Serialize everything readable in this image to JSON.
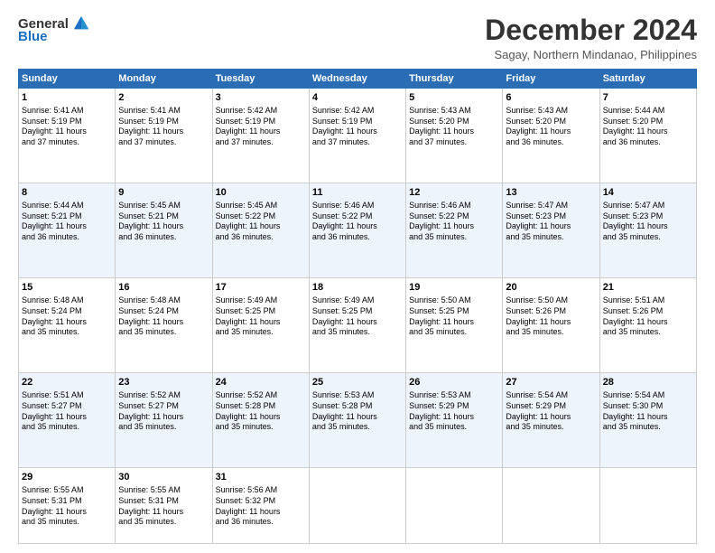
{
  "logo": {
    "general": "General",
    "blue": "Blue"
  },
  "title": "December 2024",
  "location": "Sagay, Northern Mindanao, Philippines",
  "headers": [
    "Sunday",
    "Monday",
    "Tuesday",
    "Wednesday",
    "Thursday",
    "Friday",
    "Saturday"
  ],
  "weeks": [
    [
      {
        "day": "1",
        "info": "Sunrise: 5:41 AM\nSunset: 5:19 PM\nDaylight: 11 hours\nand 37 minutes."
      },
      {
        "day": "2",
        "info": "Sunrise: 5:41 AM\nSunset: 5:19 PM\nDaylight: 11 hours\nand 37 minutes."
      },
      {
        "day": "3",
        "info": "Sunrise: 5:42 AM\nSunset: 5:19 PM\nDaylight: 11 hours\nand 37 minutes."
      },
      {
        "day": "4",
        "info": "Sunrise: 5:42 AM\nSunset: 5:19 PM\nDaylight: 11 hours\nand 37 minutes."
      },
      {
        "day": "5",
        "info": "Sunrise: 5:43 AM\nSunset: 5:20 PM\nDaylight: 11 hours\nand 37 minutes."
      },
      {
        "day": "6",
        "info": "Sunrise: 5:43 AM\nSunset: 5:20 PM\nDaylight: 11 hours\nand 36 minutes."
      },
      {
        "day": "7",
        "info": "Sunrise: 5:44 AM\nSunset: 5:20 PM\nDaylight: 11 hours\nand 36 minutes."
      }
    ],
    [
      {
        "day": "8",
        "info": "Sunrise: 5:44 AM\nSunset: 5:21 PM\nDaylight: 11 hours\nand 36 minutes."
      },
      {
        "day": "9",
        "info": "Sunrise: 5:45 AM\nSunset: 5:21 PM\nDaylight: 11 hours\nand 36 minutes."
      },
      {
        "day": "10",
        "info": "Sunrise: 5:45 AM\nSunset: 5:22 PM\nDaylight: 11 hours\nand 36 minutes."
      },
      {
        "day": "11",
        "info": "Sunrise: 5:46 AM\nSunset: 5:22 PM\nDaylight: 11 hours\nand 36 minutes."
      },
      {
        "day": "12",
        "info": "Sunrise: 5:46 AM\nSunset: 5:22 PM\nDaylight: 11 hours\nand 35 minutes."
      },
      {
        "day": "13",
        "info": "Sunrise: 5:47 AM\nSunset: 5:23 PM\nDaylight: 11 hours\nand 35 minutes."
      },
      {
        "day": "14",
        "info": "Sunrise: 5:47 AM\nSunset: 5:23 PM\nDaylight: 11 hours\nand 35 minutes."
      }
    ],
    [
      {
        "day": "15",
        "info": "Sunrise: 5:48 AM\nSunset: 5:24 PM\nDaylight: 11 hours\nand 35 minutes."
      },
      {
        "day": "16",
        "info": "Sunrise: 5:48 AM\nSunset: 5:24 PM\nDaylight: 11 hours\nand 35 minutes."
      },
      {
        "day": "17",
        "info": "Sunrise: 5:49 AM\nSunset: 5:25 PM\nDaylight: 11 hours\nand 35 minutes."
      },
      {
        "day": "18",
        "info": "Sunrise: 5:49 AM\nSunset: 5:25 PM\nDaylight: 11 hours\nand 35 minutes."
      },
      {
        "day": "19",
        "info": "Sunrise: 5:50 AM\nSunset: 5:25 PM\nDaylight: 11 hours\nand 35 minutes."
      },
      {
        "day": "20",
        "info": "Sunrise: 5:50 AM\nSunset: 5:26 PM\nDaylight: 11 hours\nand 35 minutes."
      },
      {
        "day": "21",
        "info": "Sunrise: 5:51 AM\nSunset: 5:26 PM\nDaylight: 11 hours\nand 35 minutes."
      }
    ],
    [
      {
        "day": "22",
        "info": "Sunrise: 5:51 AM\nSunset: 5:27 PM\nDaylight: 11 hours\nand 35 minutes."
      },
      {
        "day": "23",
        "info": "Sunrise: 5:52 AM\nSunset: 5:27 PM\nDaylight: 11 hours\nand 35 minutes."
      },
      {
        "day": "24",
        "info": "Sunrise: 5:52 AM\nSunset: 5:28 PM\nDaylight: 11 hours\nand 35 minutes."
      },
      {
        "day": "25",
        "info": "Sunrise: 5:53 AM\nSunset: 5:28 PM\nDaylight: 11 hours\nand 35 minutes."
      },
      {
        "day": "26",
        "info": "Sunrise: 5:53 AM\nSunset: 5:29 PM\nDaylight: 11 hours\nand 35 minutes."
      },
      {
        "day": "27",
        "info": "Sunrise: 5:54 AM\nSunset: 5:29 PM\nDaylight: 11 hours\nand 35 minutes."
      },
      {
        "day": "28",
        "info": "Sunrise: 5:54 AM\nSunset: 5:30 PM\nDaylight: 11 hours\nand 35 minutes."
      }
    ],
    [
      {
        "day": "29",
        "info": "Sunrise: 5:55 AM\nSunset: 5:31 PM\nDaylight: 11 hours\nand 35 minutes."
      },
      {
        "day": "30",
        "info": "Sunrise: 5:55 AM\nSunset: 5:31 PM\nDaylight: 11 hours\nand 35 minutes."
      },
      {
        "day": "31",
        "info": "Sunrise: 5:56 AM\nSunset: 5:32 PM\nDaylight: 11 hours\nand 36 minutes."
      },
      {
        "day": "",
        "info": ""
      },
      {
        "day": "",
        "info": ""
      },
      {
        "day": "",
        "info": ""
      },
      {
        "day": "",
        "info": ""
      }
    ]
  ]
}
